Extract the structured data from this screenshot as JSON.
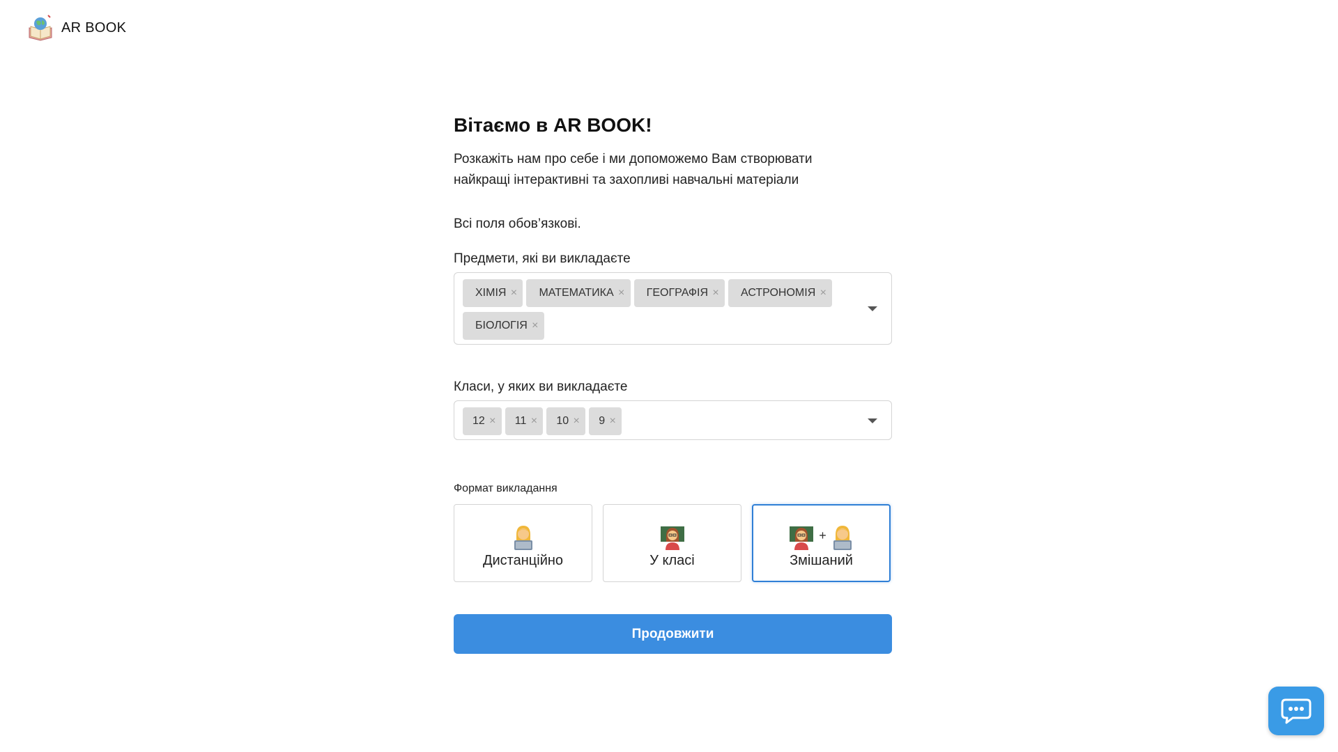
{
  "brand": {
    "name": "AR BOOK"
  },
  "welcome": {
    "title": "Вітаємо в AR BOOK!",
    "subtitle": "Розкажіть нам про себе і ми допоможемо Вам створювати найкращі інтерактивні та захопливі навчальні матеріали",
    "required_note": "Всі поля обов’язкові."
  },
  "subjects": {
    "label": "Предмети, які ви викладаєте",
    "selected": [
      "ХІМІЯ",
      "МАТЕМАТИКА",
      "ГЕОГРАФІЯ",
      "АСТРОНОМІЯ",
      "БІОЛОГІЯ"
    ]
  },
  "grades": {
    "label": "Класи, у яких ви викладаєте",
    "selected": [
      "12",
      "11",
      "10",
      "9"
    ]
  },
  "format": {
    "label": "Формат викладання",
    "options": [
      {
        "label": "Дистанційно",
        "icon": "remote-teacher-icon",
        "selected": false
      },
      {
        "label": "У класі",
        "icon": "classroom-teacher-icon",
        "selected": false
      },
      {
        "label": "Змішаний",
        "icon": "mixed-format-icon",
        "selected": true
      }
    ],
    "mixed_plus": "+"
  },
  "actions": {
    "continue_label": "Продовжити"
  },
  "colors": {
    "accent": "#3b8de0",
    "chip_bg": "#dcdcdc",
    "chat_bg": "#3a9be6"
  }
}
